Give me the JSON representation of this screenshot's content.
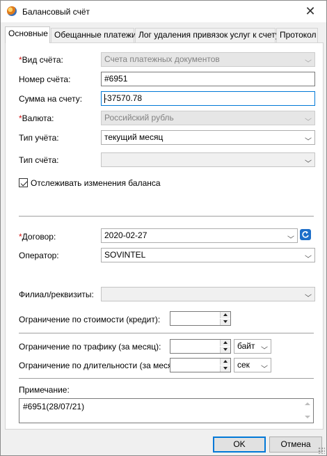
{
  "window": {
    "title": "Балансовый счёт",
    "close_glyph": "✕"
  },
  "tabs": [
    {
      "label": "Основные",
      "active": true
    },
    {
      "label": "Обещанные платежи",
      "active": false
    },
    {
      "label": "Лог удаления привязок услуг к счету",
      "active": false
    },
    {
      "label": "Протокол",
      "active": false
    }
  ],
  "form": {
    "account_type": {
      "label": "Вид счёта:",
      "required": true,
      "value": "Счета платежных документов",
      "enabled": false
    },
    "account_number": {
      "label": "Номер счёта:",
      "value": "#6951"
    },
    "balance": {
      "label": "Сумма на счету:",
      "value": "-37570.78"
    },
    "currency": {
      "label": "Валюта:",
      "required": true,
      "value": "Российский рубль",
      "enabled": false
    },
    "accounting_type": {
      "label": "Тип учёта:",
      "value": "текущий месяц"
    },
    "account_kind": {
      "label": "Тип счёта:",
      "value": ""
    },
    "track_balance": {
      "label": "Отслеживать изменения баланса",
      "checked": true
    },
    "contract": {
      "label": "Договор:",
      "required": true,
      "value": "2020-02-27"
    },
    "operator": {
      "label": "Оператор:",
      "value": "SOVINTEL"
    },
    "branch": {
      "label": "Филиал/реквизиты:",
      "value": ""
    },
    "cost_limit": {
      "label": "Ограничение по стоимости (кредит):",
      "value": ""
    },
    "traffic_limit": {
      "label": "Ограничение по трафику (за месяц):",
      "value": "",
      "unit": "байт"
    },
    "duration_limit": {
      "label": "Ограничение по длительности (за месяц):",
      "value": "",
      "unit": "сек"
    },
    "note": {
      "label": "Примечание:",
      "value": "#6951(28/07/21)"
    }
  },
  "buttons": {
    "ok": "OK",
    "cancel": "Отмена"
  },
  "colors": {
    "required_star": "#d01010",
    "accent": "#0078d7"
  }
}
